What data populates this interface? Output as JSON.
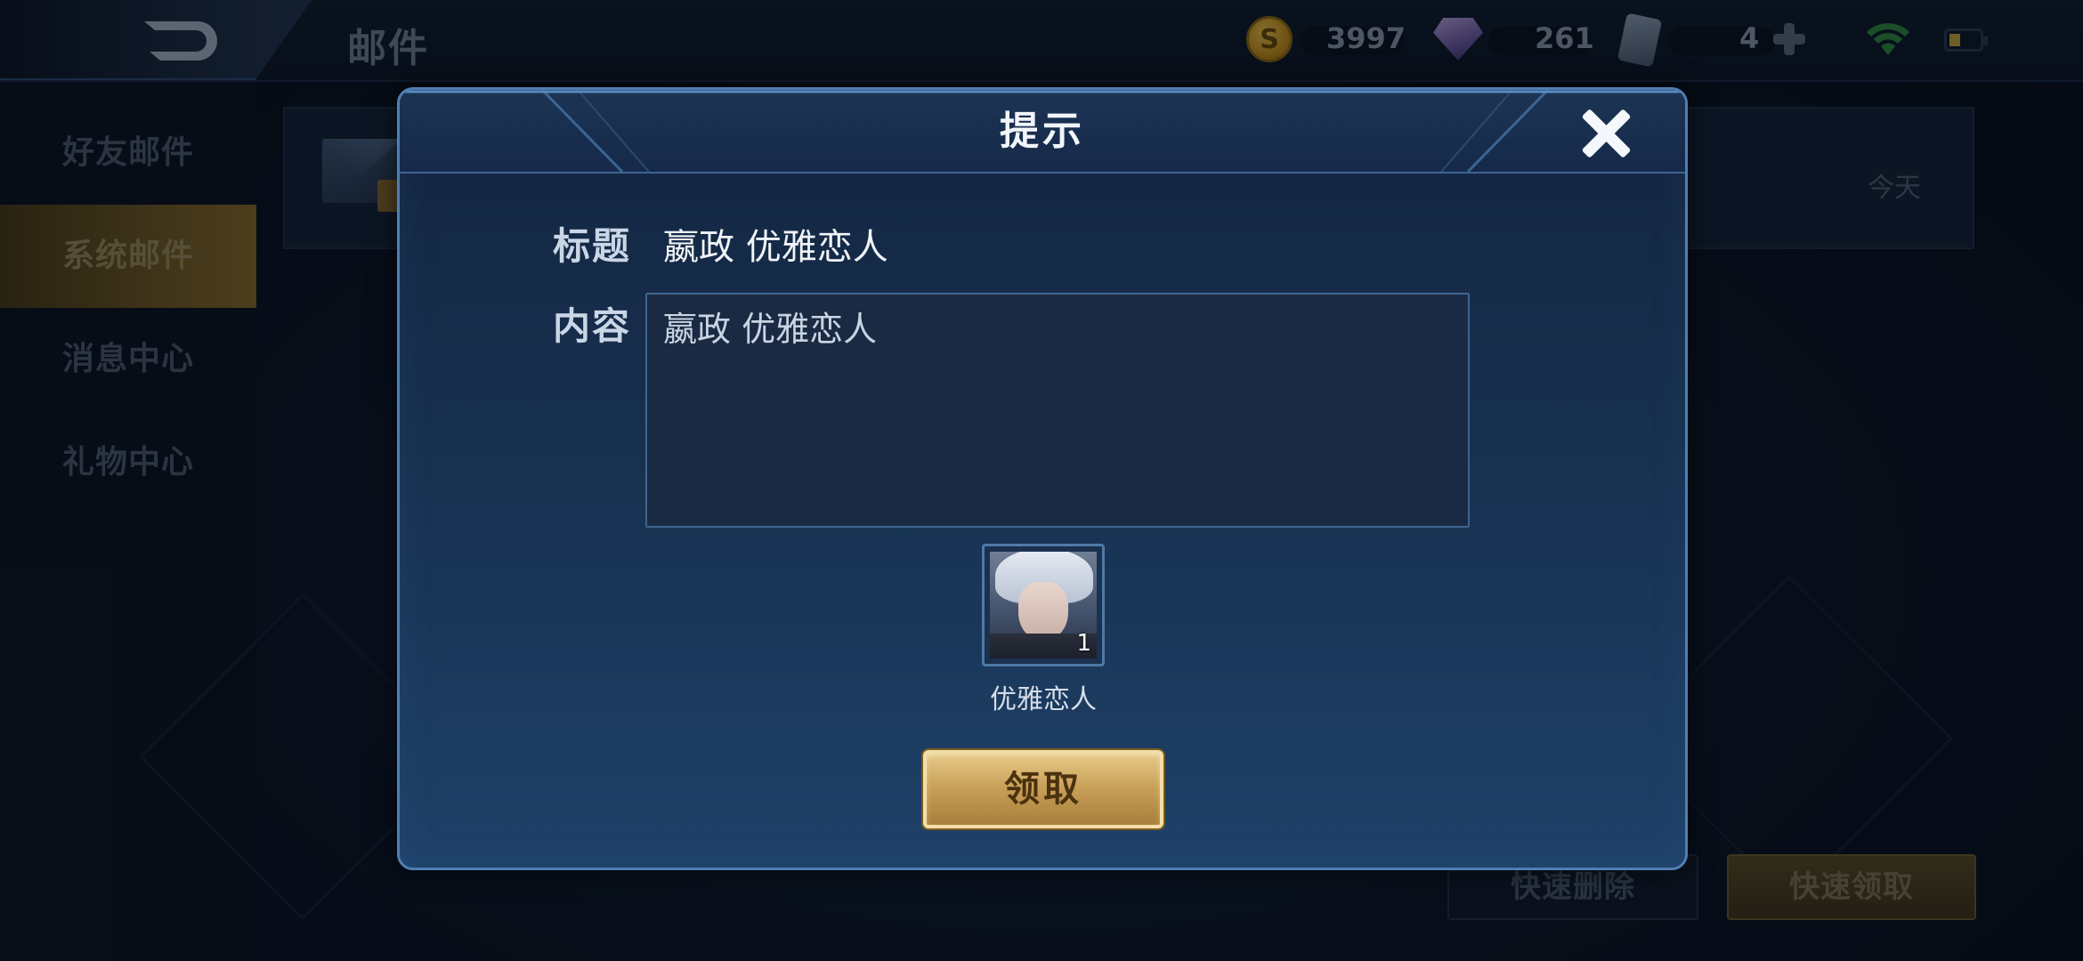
{
  "topbar": {
    "page_title": "邮件",
    "gold": "3997",
    "diamonds": "261",
    "tickets": "4"
  },
  "sidebar": {
    "items": [
      {
        "label": "好友邮件"
      },
      {
        "label": "系统邮件"
      },
      {
        "label": "消息中心"
      },
      {
        "label": "礼物中心"
      }
    ],
    "active_index": 1
  },
  "mail_list": {
    "first_item_date": "今天"
  },
  "bottom_actions": {
    "quick_delete": "快速删除",
    "quick_claim": "快速领取"
  },
  "dialog": {
    "title": "提示",
    "subject_label": "标题",
    "subject_value": "嬴政 优雅恋人",
    "content_label": "内容",
    "content_value": "嬴政 优雅恋人",
    "reward": {
      "name": "优雅恋人",
      "count": "1"
    },
    "claim_button": "领取"
  },
  "colors": {
    "accent_gold": "#caa25a",
    "dialog_border": "#4f7fb3",
    "active_tab": "#6e5622"
  },
  "icons": [
    "back-icon",
    "coin-icon",
    "gem-icon",
    "ticket-icon",
    "plus-icon",
    "wifi-icon",
    "battery-icon",
    "close-icon",
    "mail-icon",
    "gift-icon"
  ]
}
